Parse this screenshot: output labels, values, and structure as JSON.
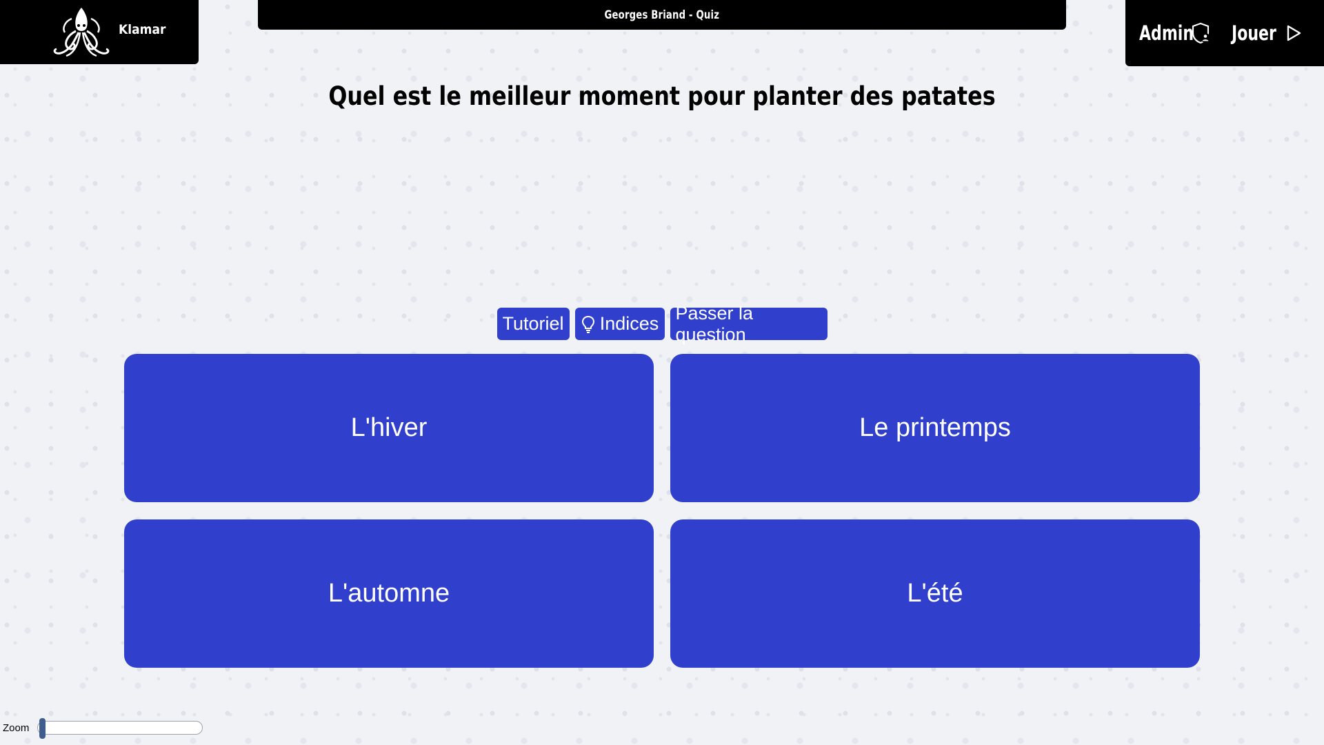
{
  "header": {
    "logo": {
      "text": "Klamar",
      "icon": "kraken-icon"
    },
    "title": "Georges Briand - Quiz",
    "nav": {
      "admin_label": "Admin",
      "admin_icon": "shield-user-icon",
      "play_label": "Jouer",
      "play_icon": "play-icon"
    }
  },
  "question": {
    "text": "Quel est le meilleur moment pour planter des patates"
  },
  "actions": {
    "tutorial_label": "Tutoriel",
    "hints_label": "Indices",
    "hints_icon": "lightbulb-icon",
    "skip_label": "Passer la question"
  },
  "answers": [
    {
      "label": "L'hiver"
    },
    {
      "label": "Le printemps"
    },
    {
      "label": "L'automne"
    },
    {
      "label": "L'été"
    }
  ],
  "zoom": {
    "label": "Zoom",
    "level": 0
  },
  "colors": {
    "accent": "#3040cc",
    "header_background": "#000000",
    "page_background": "#f1f2f6",
    "zoom_handle": "#3f5e8f"
  }
}
